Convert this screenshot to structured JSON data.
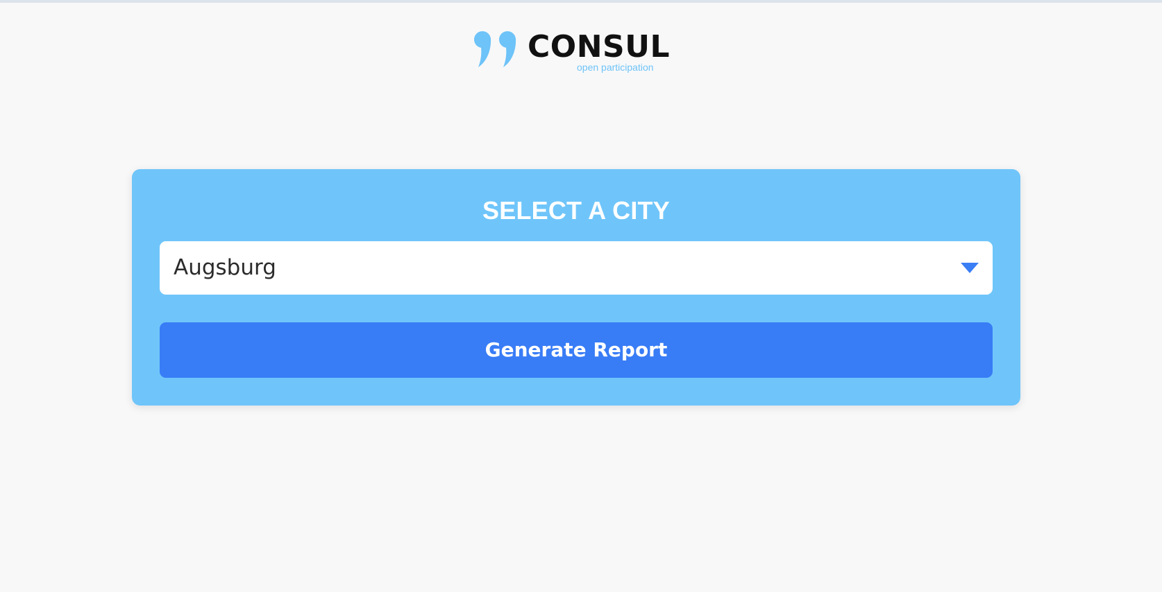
{
  "brand": {
    "name": "CONSUL",
    "tagline": "open participation",
    "logo_icon": "double-quote-marks",
    "accent_color": "#6ec3f8"
  },
  "city_picker": {
    "title": "SELECT A CITY",
    "selected_city": "Augsburg",
    "dropdown_icon": "chevron-down-icon",
    "panel_color": "#6fc5fa"
  },
  "actions": {
    "generate_label": "Generate Report",
    "button_color": "#387cf6"
  }
}
